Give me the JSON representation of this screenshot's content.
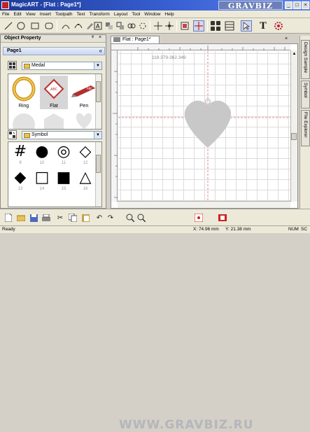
{
  "window": {
    "title": "MagicART - [Flat : Page1*]"
  },
  "brand": {
    "logo_text": "GRAVBIZ",
    "watermark_text": "WWW.GRAVBIZ.RU"
  },
  "menu": [
    "File",
    "Edit",
    "View",
    "Insert",
    "Toolpath",
    "Text",
    "Transform",
    "Layout",
    "Tool",
    "Window",
    "Help"
  ],
  "toolbar_icons": [
    "pen-icon",
    "ellipse-icon",
    "rectangle-icon",
    "rounded-rectangle-icon",
    "node-edit-icon",
    "smooth-icon",
    "brush-icon",
    "text-frame-icon",
    "weld-icon",
    "trim-icon",
    "join-icon",
    "break-icon",
    "align-icon",
    "position-icon",
    "crop-icon",
    "guide-icon",
    "grid-icon",
    "list-icon",
    "select-icon",
    "text-icon",
    "gear-icon"
  ],
  "left_panel": {
    "header": "Object Property",
    "page_label": "Page1",
    "category_dropdown": "Medal",
    "medals": [
      {
        "label": "Ring",
        "icon": "ring-icon"
      },
      {
        "label": "Flat",
        "icon": "flat-medal-icon"
      },
      {
        "label": "Pen",
        "icon": "pen-medal-icon"
      }
    ],
    "symbol_dropdown": "Symbol",
    "symbols": [
      {
        "glyph": "#",
        "num": "9"
      },
      {
        "glyph": "●",
        "num": "10"
      },
      {
        "glyph": "◎",
        "num": "11"
      },
      {
        "glyph": "◇",
        "num": "12"
      },
      {
        "glyph": "◆",
        "num": "13"
      },
      {
        "glyph": "□",
        "num": "14"
      },
      {
        "glyph": "■",
        "num": "15"
      },
      {
        "glyph": "△",
        "num": "16"
      }
    ]
  },
  "document": {
    "tab_label": "Flat : Page1*",
    "coords": "118.379-362.349"
  },
  "right_tabs": [
    "Design Sample",
    "Symbol",
    "File Explorer"
  ],
  "status": {
    "left": "Ready",
    "position": "X: 74.96 mm",
    "y_position": "Y: 21.38 mm",
    "num": "NUM",
    "scrl": "SC"
  },
  "colors": {
    "heart": "#c8c8c8",
    "title_bar": "#1c3a9a",
    "canvas_grid": "#dcdcdc"
  }
}
